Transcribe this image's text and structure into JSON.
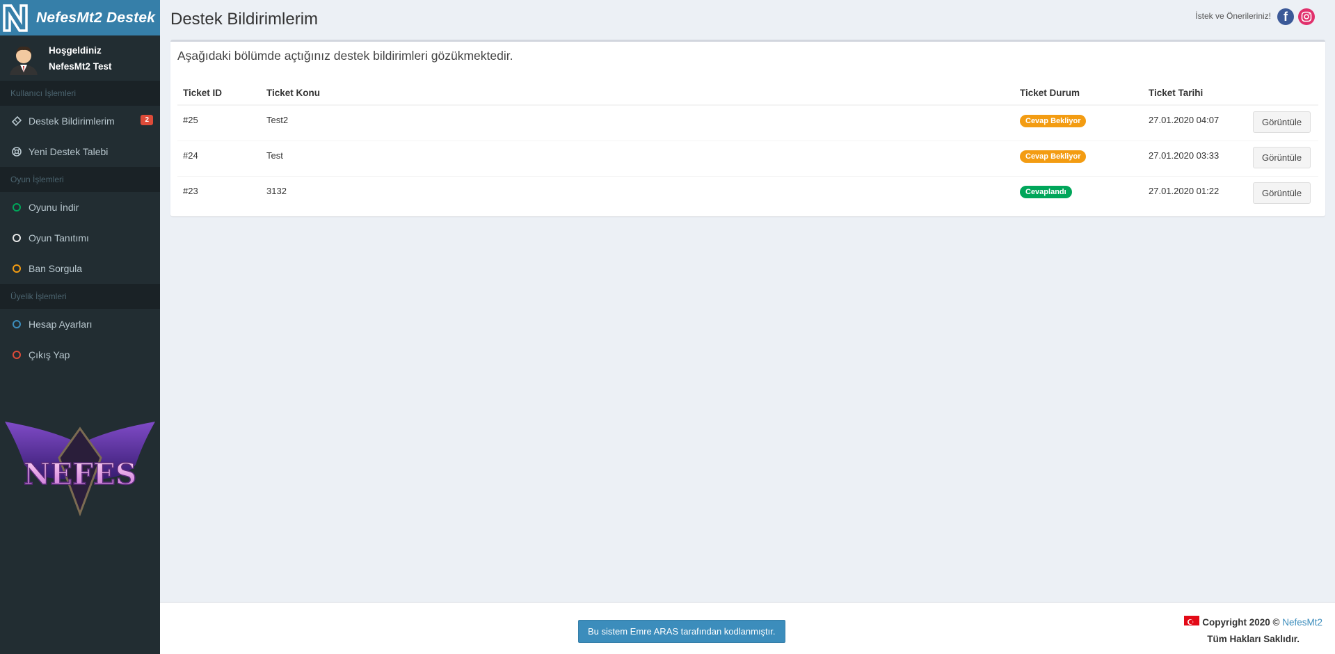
{
  "brand": {
    "title": "NefesMt2 Destek"
  },
  "user": {
    "greeting": "Hoşgeldiniz",
    "name": "NefesMt2 Test"
  },
  "sidebar": {
    "header1": "Kullanıcı İşlemleri",
    "item_tickets": "Destek Bildirimlerim",
    "item_tickets_badge": "2",
    "item_new": "Yeni Destek Talebi",
    "header2": "Oyun İşlemleri",
    "item_download": "Oyunu İndir",
    "item_intro": "Oyun Tanıtımı",
    "item_ban": "Ban Sorgula",
    "header3": "Üyelik İşlemleri",
    "item_account": "Hesap Ayarları",
    "item_logout": "Çıkış Yap",
    "logo_text": "NEFES"
  },
  "header": {
    "title": "Destek Bildirimlerim",
    "suggest": "İstek ve Önerileriniz!"
  },
  "main": {
    "description": "Aşağıdaki bölümde açtığınız destek bildirimleri gözükmektedir.",
    "columns": [
      "Ticket ID",
      "Ticket Konu",
      "Ticket Durum",
      "Ticket Tarihi"
    ],
    "rows": [
      {
        "id": "#25",
        "subject": "Test2",
        "status": "Cevap Bekliyor",
        "date": "27.01.2020 04:07",
        "action": "Görüntüle"
      },
      {
        "id": "#24",
        "subject": "Test",
        "status": "Cevap Bekliyor",
        "date": "27.01.2020 03:33",
        "action": "Görüntüle"
      },
      {
        "id": "#23",
        "subject": "3132",
        "status": "Cevaplandı",
        "date": "27.01.2020 01:22",
        "action": "Görüntüle"
      }
    ]
  },
  "footer": {
    "credit": "Bu sistem Emre ARAS tarafından kodlanmıştır.",
    "copyright": "Copyright 2020 ©",
    "copyright_link": "NefesMt2",
    "rights": "Tüm Hakları Saklıdır."
  },
  "colors": {
    "brand": "#367fa9",
    "sidebar": "#222d32",
    "pending": "#f39c12",
    "answered": "#00a65a",
    "badge": "#dd4b39"
  }
}
